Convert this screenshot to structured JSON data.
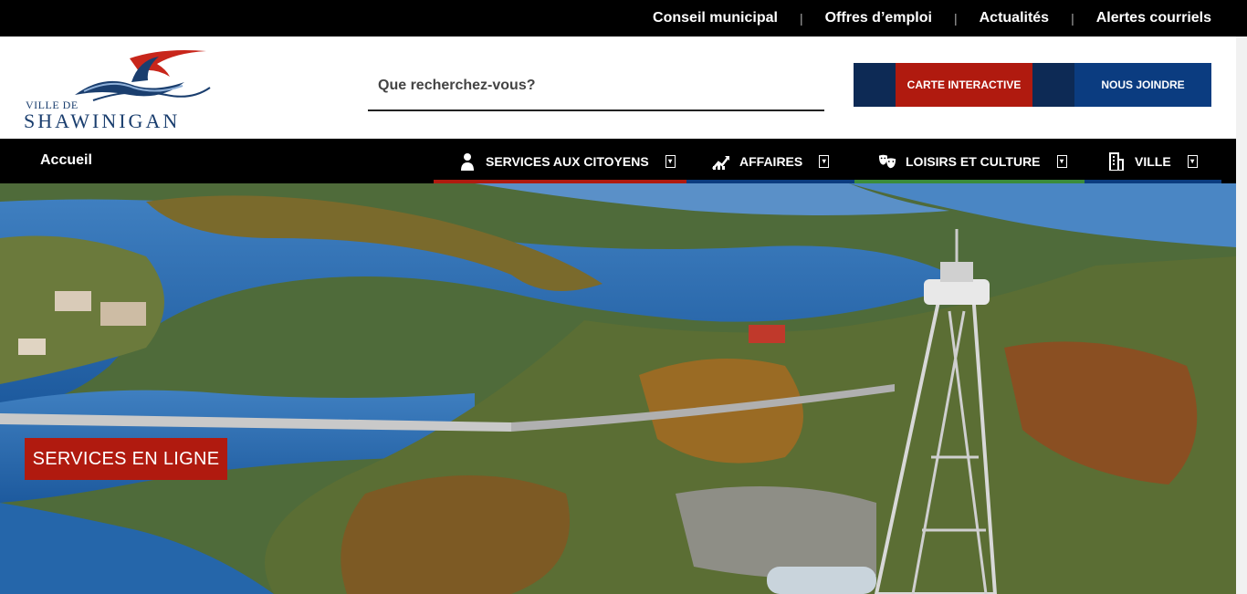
{
  "topbar": {
    "links": [
      "Conseil municipal",
      "Offres d’emploi",
      "Actualités",
      "Alertes courriels"
    ]
  },
  "logo": {
    "prefix": "VILLE DE",
    "name": "SHAWINIGAN"
  },
  "search": {
    "placeholder": "Que recherchez-vous?"
  },
  "header_buttons": {
    "map": "CARTE INTERACTIVE",
    "contact": "NOUS JOINDRE"
  },
  "nav": {
    "home": "Accueil",
    "items": [
      {
        "label": "SERVICES AUX CITOYENS",
        "icon": "person-icon",
        "accent": "#b01a0f"
      },
      {
        "label": "AFFAIRES",
        "icon": "chart-growth-icon",
        "accent": "#0b3c80"
      },
      {
        "label": "LOISIRS ET CULTURE",
        "icon": "theater-masks-icon",
        "accent": "#3b8c3b"
      },
      {
        "label": "VILLE",
        "icon": "building-icon",
        "accent": "#0b3c80"
      }
    ]
  },
  "hero": {
    "cta": "SERVICES EN LIGNE"
  },
  "colors": {
    "brand_red": "#b01a0f",
    "brand_navy": "#0d2a55",
    "brand_blue": "#0b3c80"
  }
}
